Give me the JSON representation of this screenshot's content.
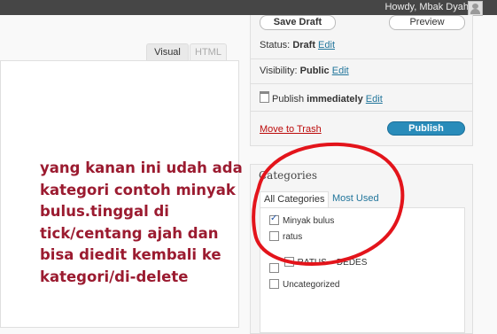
{
  "topbar": {
    "howdy": "Howdy, Mbak Dyah",
    "avatar_icon": "avatar-icon"
  },
  "editor": {
    "tab_visual": "Visual",
    "tab_html": "HTML"
  },
  "publish": {
    "save_draft": "Save Draft",
    "preview": "Preview",
    "status_label": "Status:",
    "status_value": "Draft",
    "status_edit": "Edit",
    "visibility_label": "Visibility:",
    "visibility_value": "Public",
    "visibility_edit": "Edit",
    "publish_label": "Publish",
    "publish_value": "immediately",
    "publish_edit": "Edit",
    "calendar_icon": "calendar-icon",
    "move_to_trash": "Move to Trash",
    "publish_button": "Publish"
  },
  "categories": {
    "title": "Categories",
    "tab_all": "All Categories",
    "tab_most_used": "Most Used",
    "items": [
      {
        "label": "Minyak bulus",
        "checked": true
      },
      {
        "label": "ratus",
        "checked": false
      },
      {
        "label": "RATUS    DEDES",
        "checked": false
      },
      {
        "label": "",
        "checked": false
      },
      {
        "label": "Uncategorized",
        "checked": false
      }
    ]
  },
  "annotation": {
    "lines": [
      "yang kanan ini udah ada",
      "kategori contoh minyak",
      "bulus.tinggal di",
      "tick/centang ajah dan",
      "bisa diedit kembali ke",
      "kategori/di-delete"
    ]
  },
  "colors": {
    "topbar": "#464646",
    "link": "#21759b",
    "publish_button": "#298cba",
    "trash": "#bc0b0b",
    "annotation_text": "#9b1b30",
    "annotation_ellipse": "#e3141b"
  }
}
